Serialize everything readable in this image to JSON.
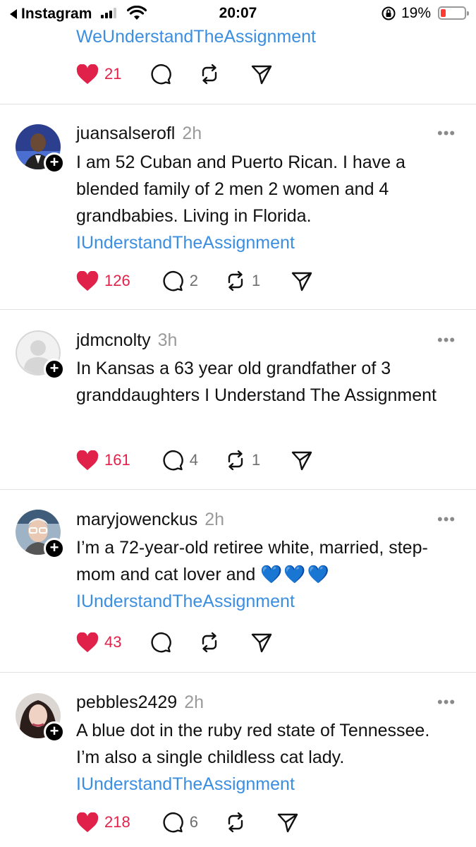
{
  "status_bar": {
    "back_label": "Instagram",
    "time": "20:07",
    "battery_pct": "19%"
  },
  "top_post": {
    "link": "WeUnderstandTheAssignment",
    "likes": "21"
  },
  "posts": [
    {
      "username": "juansalserofl",
      "time": "2h",
      "text": "I am 52 Cuban and Puerto Rican. I have a blended family of 2 men 2 women and 4 grandbabies. Living in Florida.",
      "link": "IUnderstandTheAssignment",
      "likes": "126",
      "replies": "2",
      "reposts": "1"
    },
    {
      "username": "jdmcnolty",
      "time": "3h",
      "text": "In Kansas a 63 year old grandfather of 3 granddaughters I Understand The Assignment",
      "link": "",
      "likes": "161",
      "replies": "4",
      "reposts": "1"
    },
    {
      "username": "maryjowenckus",
      "time": "2h",
      "text": "I’m a 72-year-old retiree white, married, step-mom and cat lover and",
      "emoji": "💙💙💙",
      "link": "IUnderstandTheAssignment",
      "likes": "43",
      "replies": "",
      "reposts": ""
    },
    {
      "username": "pebbles2429",
      "time": "2h",
      "text": "A blue dot in the ruby red state of Tennessee. I’m also a single childless cat lady.",
      "link": "IUnderstandTheAssignment",
      "likes": "218",
      "replies": "6",
      "reposts": ""
    }
  ],
  "colors": {
    "like": "#e0224b",
    "link": "#3b8ee0",
    "divider": "#e2e2e2"
  },
  "icons": {
    "like": "heart-icon",
    "reply": "comment-icon",
    "repost": "repost-icon",
    "share": "send-icon",
    "more": "more-icon",
    "follow": "plus-icon"
  }
}
